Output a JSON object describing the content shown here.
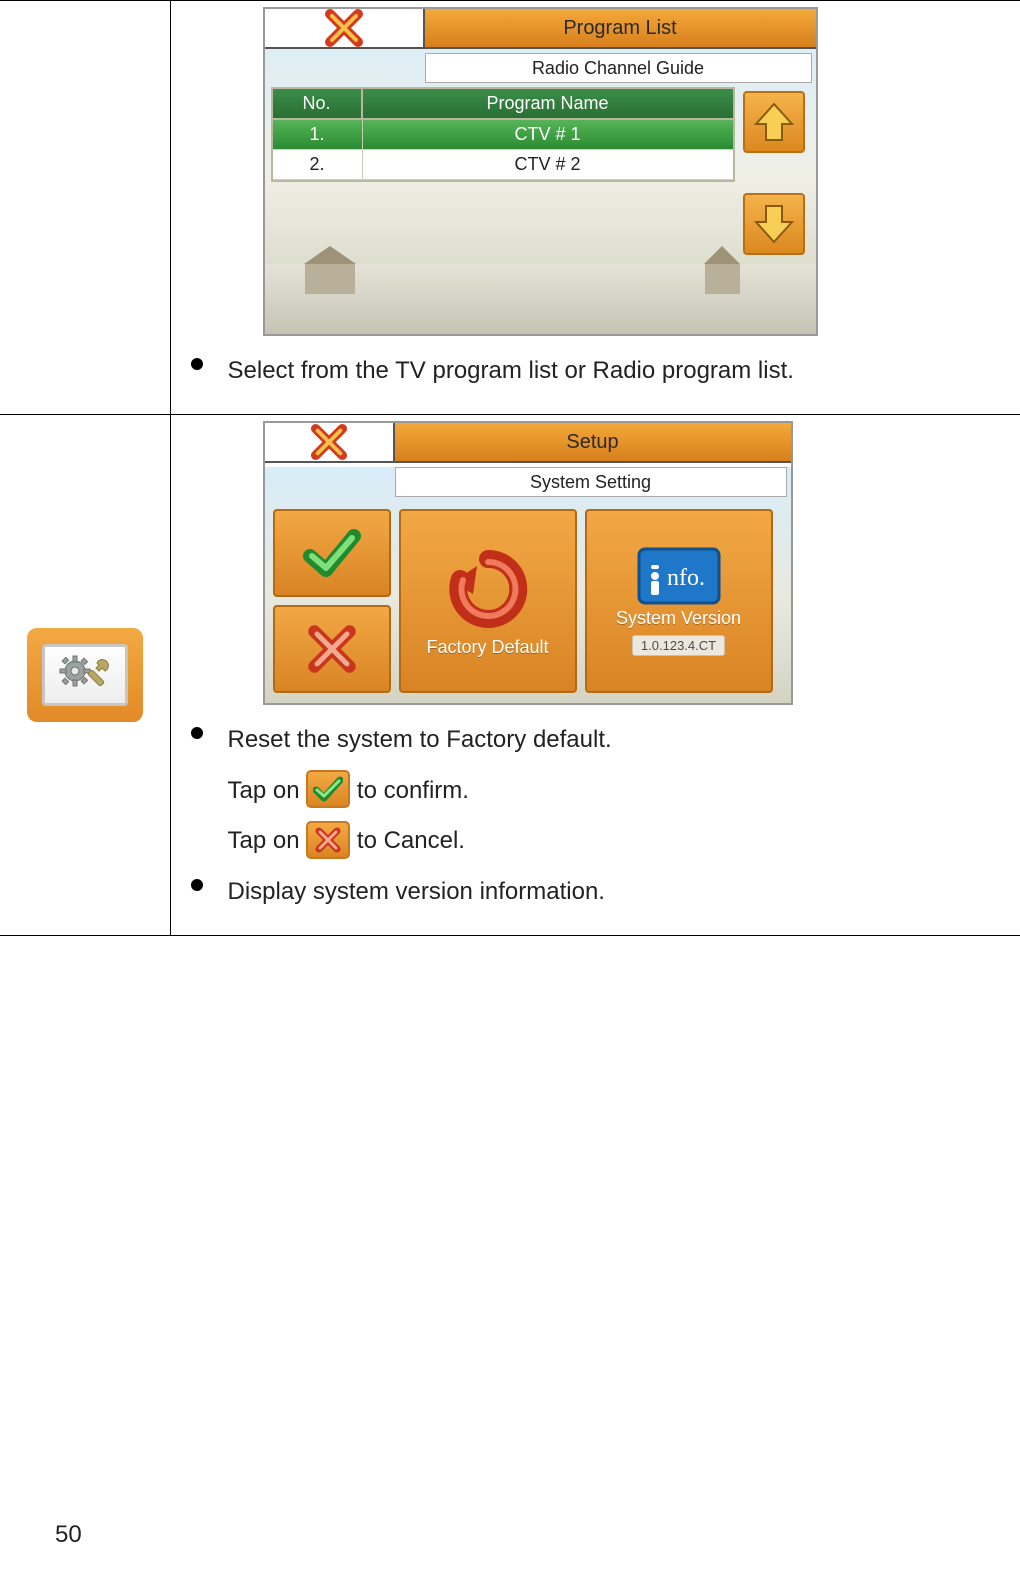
{
  "row1": {
    "screenshot": {
      "title": "Program List",
      "subtitle": "Radio Channel Guide",
      "columns": {
        "no": "No.",
        "name": "Program Name"
      },
      "rows": [
        {
          "no": "1.",
          "name": "CTV # 1",
          "selected": true
        },
        {
          "no": "2.",
          "name": "CTV # 2",
          "selected": false
        }
      ]
    },
    "bullet": "Select from the TV program list or Radio program list."
  },
  "row2": {
    "screenshot": {
      "title": "Setup",
      "subtitle": "System Setting",
      "factory_label": "Factory Default",
      "info_badge": "nfo.",
      "version_label": "System Version",
      "version_value": "1.0.123.4.CT"
    },
    "bullets": {
      "b1": "Reset the system to Factory default.",
      "tap_prefix": "Tap on ",
      "confirm_suffix": " to confirm.",
      "cancel_suffix": " to Cancel.",
      "b2": "Display system version information."
    }
  },
  "page_number": "50"
}
